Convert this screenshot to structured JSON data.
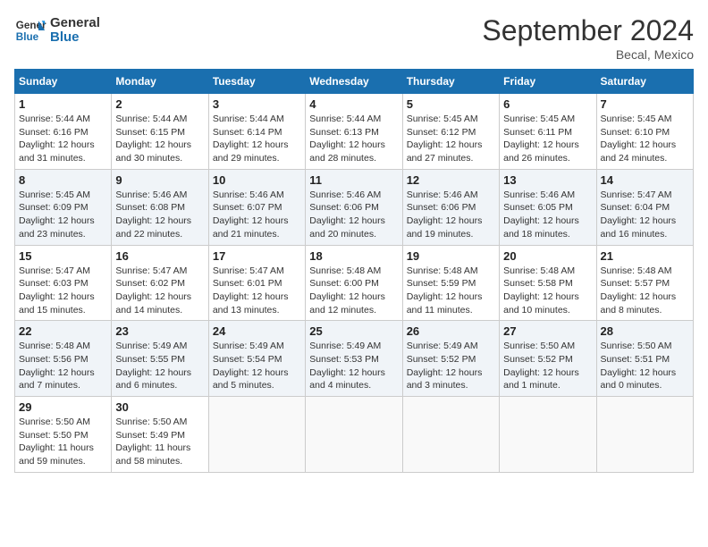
{
  "header": {
    "logo_line1": "General",
    "logo_line2": "Blue",
    "month_title": "September 2024",
    "location": "Becal, Mexico"
  },
  "weekdays": [
    "Sunday",
    "Monday",
    "Tuesday",
    "Wednesday",
    "Thursday",
    "Friday",
    "Saturday"
  ],
  "weeks": [
    [
      {
        "day": "1",
        "sunrise": "Sunrise: 5:44 AM",
        "sunset": "Sunset: 6:16 PM",
        "daylight": "Daylight: 12 hours and 31 minutes."
      },
      {
        "day": "2",
        "sunrise": "Sunrise: 5:44 AM",
        "sunset": "Sunset: 6:15 PM",
        "daylight": "Daylight: 12 hours and 30 minutes."
      },
      {
        "day": "3",
        "sunrise": "Sunrise: 5:44 AM",
        "sunset": "Sunset: 6:14 PM",
        "daylight": "Daylight: 12 hours and 29 minutes."
      },
      {
        "day": "4",
        "sunrise": "Sunrise: 5:44 AM",
        "sunset": "Sunset: 6:13 PM",
        "daylight": "Daylight: 12 hours and 28 minutes."
      },
      {
        "day": "5",
        "sunrise": "Sunrise: 5:45 AM",
        "sunset": "Sunset: 6:12 PM",
        "daylight": "Daylight: 12 hours and 27 minutes."
      },
      {
        "day": "6",
        "sunrise": "Sunrise: 5:45 AM",
        "sunset": "Sunset: 6:11 PM",
        "daylight": "Daylight: 12 hours and 26 minutes."
      },
      {
        "day": "7",
        "sunrise": "Sunrise: 5:45 AM",
        "sunset": "Sunset: 6:10 PM",
        "daylight": "Daylight: 12 hours and 24 minutes."
      }
    ],
    [
      {
        "day": "8",
        "sunrise": "Sunrise: 5:45 AM",
        "sunset": "Sunset: 6:09 PM",
        "daylight": "Daylight: 12 hours and 23 minutes."
      },
      {
        "day": "9",
        "sunrise": "Sunrise: 5:46 AM",
        "sunset": "Sunset: 6:08 PM",
        "daylight": "Daylight: 12 hours and 22 minutes."
      },
      {
        "day": "10",
        "sunrise": "Sunrise: 5:46 AM",
        "sunset": "Sunset: 6:07 PM",
        "daylight": "Daylight: 12 hours and 21 minutes."
      },
      {
        "day": "11",
        "sunrise": "Sunrise: 5:46 AM",
        "sunset": "Sunset: 6:06 PM",
        "daylight": "Daylight: 12 hours and 20 minutes."
      },
      {
        "day": "12",
        "sunrise": "Sunrise: 5:46 AM",
        "sunset": "Sunset: 6:06 PM",
        "daylight": "Daylight: 12 hours and 19 minutes."
      },
      {
        "day": "13",
        "sunrise": "Sunrise: 5:46 AM",
        "sunset": "Sunset: 6:05 PM",
        "daylight": "Daylight: 12 hours and 18 minutes."
      },
      {
        "day": "14",
        "sunrise": "Sunrise: 5:47 AM",
        "sunset": "Sunset: 6:04 PM",
        "daylight": "Daylight: 12 hours and 16 minutes."
      }
    ],
    [
      {
        "day": "15",
        "sunrise": "Sunrise: 5:47 AM",
        "sunset": "Sunset: 6:03 PM",
        "daylight": "Daylight: 12 hours and 15 minutes."
      },
      {
        "day": "16",
        "sunrise": "Sunrise: 5:47 AM",
        "sunset": "Sunset: 6:02 PM",
        "daylight": "Daylight: 12 hours and 14 minutes."
      },
      {
        "day": "17",
        "sunrise": "Sunrise: 5:47 AM",
        "sunset": "Sunset: 6:01 PM",
        "daylight": "Daylight: 12 hours and 13 minutes."
      },
      {
        "day": "18",
        "sunrise": "Sunrise: 5:48 AM",
        "sunset": "Sunset: 6:00 PM",
        "daylight": "Daylight: 12 hours and 12 minutes."
      },
      {
        "day": "19",
        "sunrise": "Sunrise: 5:48 AM",
        "sunset": "Sunset: 5:59 PM",
        "daylight": "Daylight: 12 hours and 11 minutes."
      },
      {
        "day": "20",
        "sunrise": "Sunrise: 5:48 AM",
        "sunset": "Sunset: 5:58 PM",
        "daylight": "Daylight: 12 hours and 10 minutes."
      },
      {
        "day": "21",
        "sunrise": "Sunrise: 5:48 AM",
        "sunset": "Sunset: 5:57 PM",
        "daylight": "Daylight: 12 hours and 8 minutes."
      }
    ],
    [
      {
        "day": "22",
        "sunrise": "Sunrise: 5:48 AM",
        "sunset": "Sunset: 5:56 PM",
        "daylight": "Daylight: 12 hours and 7 minutes."
      },
      {
        "day": "23",
        "sunrise": "Sunrise: 5:49 AM",
        "sunset": "Sunset: 5:55 PM",
        "daylight": "Daylight: 12 hours and 6 minutes."
      },
      {
        "day": "24",
        "sunrise": "Sunrise: 5:49 AM",
        "sunset": "Sunset: 5:54 PM",
        "daylight": "Daylight: 12 hours and 5 minutes."
      },
      {
        "day": "25",
        "sunrise": "Sunrise: 5:49 AM",
        "sunset": "Sunset: 5:53 PM",
        "daylight": "Daylight: 12 hours and 4 minutes."
      },
      {
        "day": "26",
        "sunrise": "Sunrise: 5:49 AM",
        "sunset": "Sunset: 5:52 PM",
        "daylight": "Daylight: 12 hours and 3 minutes."
      },
      {
        "day": "27",
        "sunrise": "Sunrise: 5:50 AM",
        "sunset": "Sunset: 5:52 PM",
        "daylight": "Daylight: 12 hours and 1 minute."
      },
      {
        "day": "28",
        "sunrise": "Sunrise: 5:50 AM",
        "sunset": "Sunset: 5:51 PM",
        "daylight": "Daylight: 12 hours and 0 minutes."
      }
    ],
    [
      {
        "day": "29",
        "sunrise": "Sunrise: 5:50 AM",
        "sunset": "Sunset: 5:50 PM",
        "daylight": "Daylight: 11 hours and 59 minutes."
      },
      {
        "day": "30",
        "sunrise": "Sunrise: 5:50 AM",
        "sunset": "Sunset: 5:49 PM",
        "daylight": "Daylight: 11 hours and 58 minutes."
      },
      null,
      null,
      null,
      null,
      null
    ]
  ]
}
